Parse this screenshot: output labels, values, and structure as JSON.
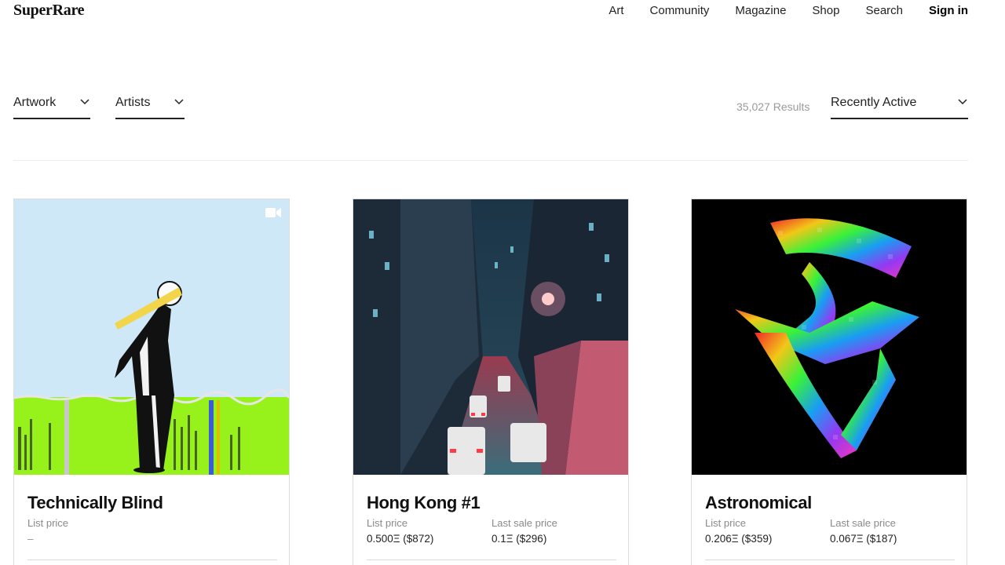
{
  "header": {
    "logo": "SuperRare",
    "nav": [
      "Art",
      "Community",
      "Magazine",
      "Shop",
      "Search",
      "Sign in"
    ]
  },
  "filters": {
    "artwork": "Artwork",
    "artists": "Artists",
    "results": "35,027 Results",
    "sort": "Recently Active"
  },
  "cards": [
    {
      "title": "Technically Blind",
      "list_label": "List price",
      "list_value": "–",
      "media_icon": "video-icon"
    },
    {
      "title": "Hong Kong #1",
      "list_label": "List price",
      "list_value": "0.500Ξ ($872)",
      "sale_label": "Last sale price",
      "sale_value": "0.1Ξ ($296)"
    },
    {
      "title": "Astronomical",
      "list_label": "List price",
      "list_value": "0.206Ξ ($359)",
      "sale_label": "Last sale price",
      "sale_value": "0.067Ξ ($187)"
    }
  ],
  "colors": {
    "sky": "#cfe8f7",
    "grass": "#96f21a",
    "city_dark": "#1d2a38",
    "city_neon": "#e0577a",
    "space": "#000000"
  }
}
